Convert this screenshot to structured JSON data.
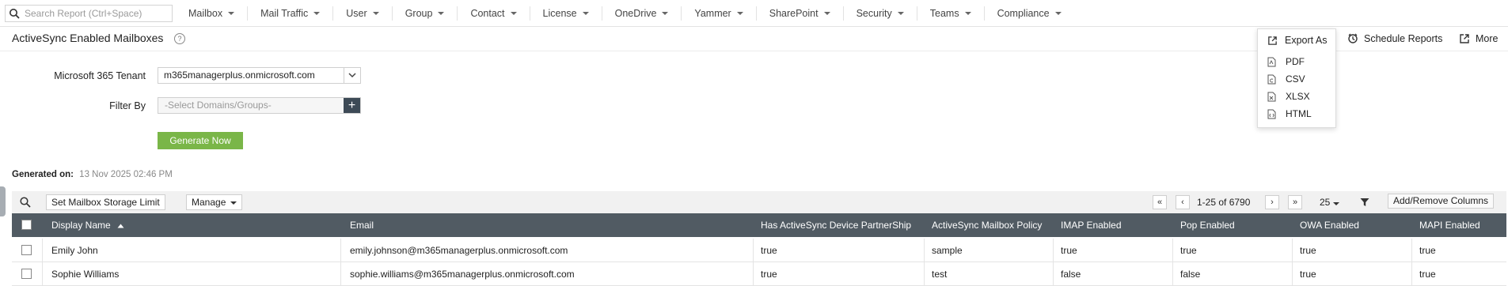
{
  "search": {
    "placeholder": "Search Report (Ctrl+Space)"
  },
  "nav": [
    "Mailbox",
    "Mail Traffic",
    "User",
    "Group",
    "Contact",
    "License",
    "OneDrive",
    "Yammer",
    "SharePoint",
    "Security",
    "Teams",
    "Compliance"
  ],
  "page": {
    "title": "ActiveSync Enabled Mailboxes",
    "help": "?"
  },
  "actions": {
    "export": "Export As",
    "schedule": "Schedule Reports",
    "more": "More"
  },
  "export_options": [
    "PDF",
    "CSV",
    "XLSX",
    "HTML"
  ],
  "form": {
    "tenant_label": "Microsoft 365 Tenant",
    "tenant_value": "m365managerplus.onmicrosoft.com",
    "filter_label": "Filter By",
    "filter_placeholder": "-Select Domains/Groups-",
    "generate": "Generate Now"
  },
  "generated": {
    "label": "Generated on:",
    "timestamp": "13 Nov 2025 02:46 PM"
  },
  "toolbar": {
    "storage_limit": "Set Mailbox Storage Limit",
    "manage": "Manage",
    "pagination": "1-25 of 6790",
    "page_size": "25",
    "add_remove": "Add/Remove Columns"
  },
  "table": {
    "columns": [
      "Display Name",
      "Email",
      "Has ActiveSync Device PartnerShip",
      "ActiveSync Mailbox Policy",
      "IMAP Enabled",
      "Pop Enabled",
      "OWA Enabled",
      "MAPI Enabled"
    ],
    "rows": [
      [
        "Emily John",
        "emily.johnson@m365managerplus.onmicrosoft.com",
        "true",
        "sample",
        "true",
        "true",
        "true",
        "true"
      ],
      [
        "Sophie Williams",
        "sophie.williams@m365managerplus.onmicrosoft.com",
        "true",
        "test",
        "false",
        "false",
        "true",
        "true"
      ]
    ]
  },
  "colors": {
    "header": "#515b63",
    "generate": "#7ab648",
    "plus": "#3d4a56"
  }
}
